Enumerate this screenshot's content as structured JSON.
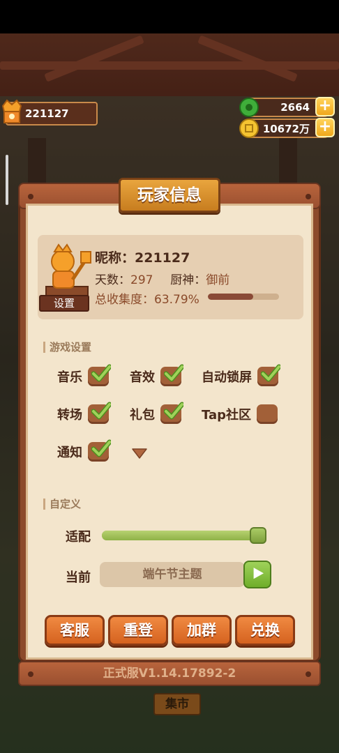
{
  "hud": {
    "player_id": "221127",
    "jade": "2664",
    "coins": "10672万"
  },
  "panel": {
    "title": "玩家信息",
    "settings_button": "设置",
    "nickname_label": "昵称：",
    "nickname": "221127",
    "days_label": "天数：",
    "days": "297",
    "chef_label": "厨神：",
    "chef": "御前",
    "collection_label": "总收集度：",
    "collection": "63.79%",
    "collection_fraction": 0.6379
  },
  "game_settings": {
    "header": "游戏设置",
    "options": [
      {
        "label": "音乐",
        "checked": true
      },
      {
        "label": "音效",
        "checked": true
      },
      {
        "label": "自动锁屏",
        "checked": true
      },
      {
        "label": "转场",
        "checked": true
      },
      {
        "label": "礼包",
        "checked": true
      },
      {
        "label": "Tap社区",
        "checked": false
      },
      {
        "label": "通知",
        "checked": true
      }
    ]
  },
  "custom": {
    "header": "自定义",
    "adapt_label": "适配",
    "adapt_level": 1.0,
    "current_label": "当前",
    "current_theme": "端午节主题"
  },
  "buttons": {
    "service": "客服",
    "relogin": "重登",
    "join_group": "加群",
    "redeem": "兑换"
  },
  "version": "正式服V1.14.17892-2",
  "background": {
    "market_sign": "集市"
  }
}
